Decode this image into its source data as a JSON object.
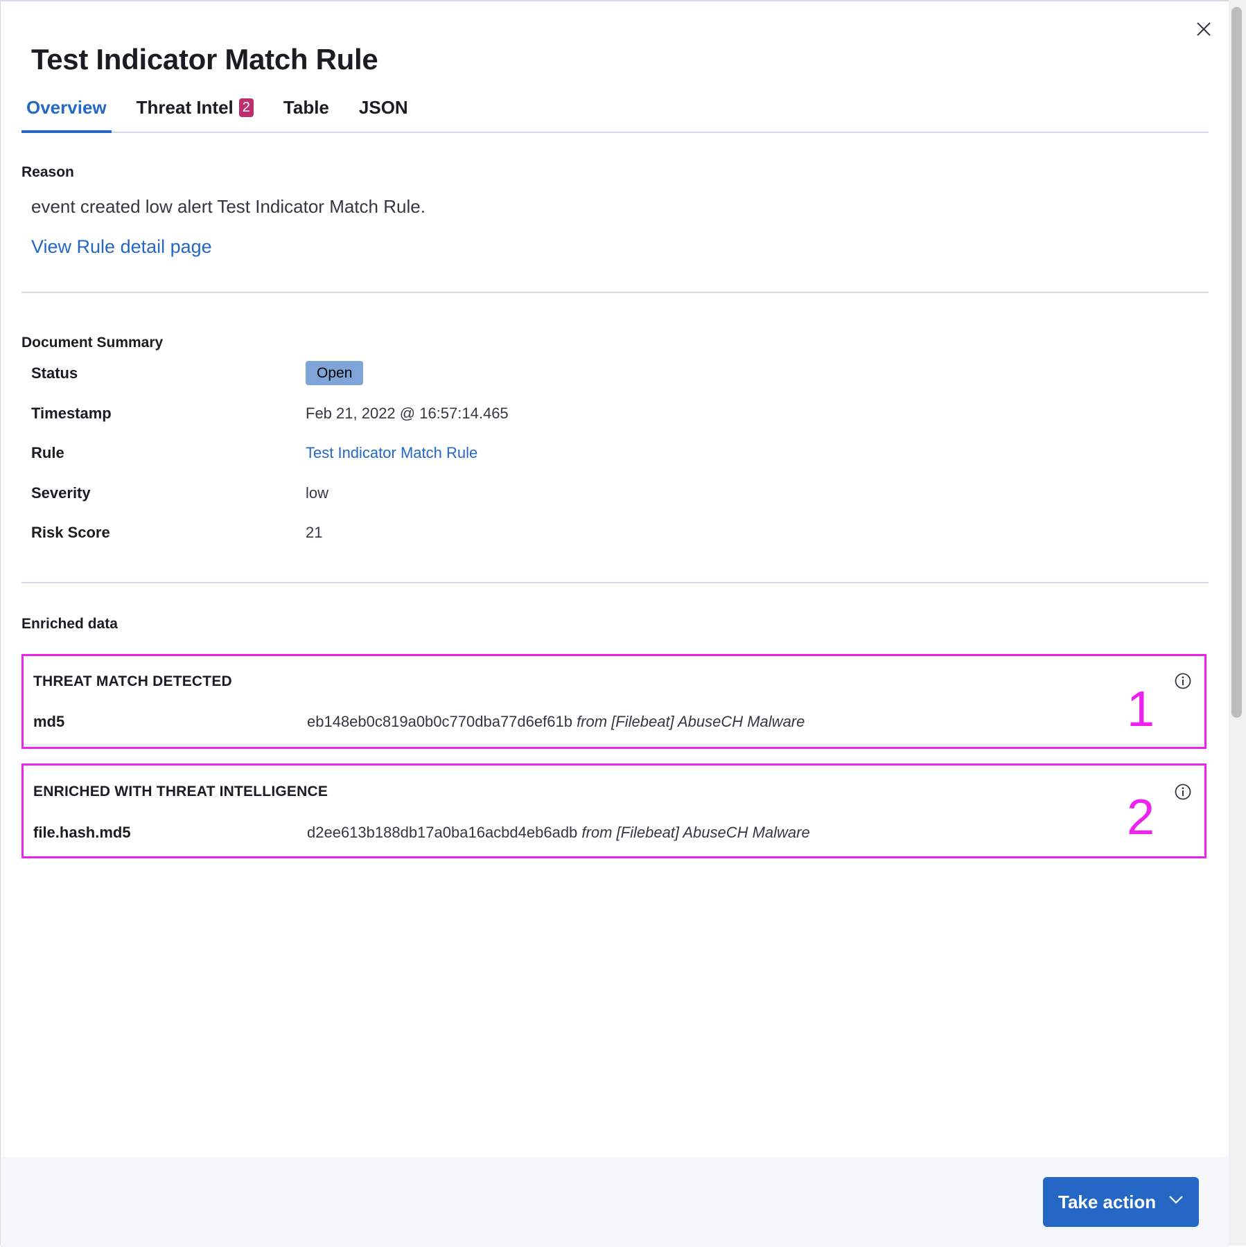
{
  "flyout": {
    "title": "Test Indicator Match Rule",
    "close_icon": "close-icon"
  },
  "tabs": [
    {
      "label": "Overview",
      "active": true
    },
    {
      "label": "Threat Intel",
      "badge": "2",
      "active": false
    },
    {
      "label": "Table",
      "active": false
    },
    {
      "label": "JSON",
      "active": false
    }
  ],
  "reason": {
    "label": "Reason",
    "text": "event created low alert Test Indicator Match Rule.",
    "link": "View Rule detail page"
  },
  "summary": {
    "label": "Document Summary",
    "rows": [
      {
        "key": "Status",
        "value": "Open"
      },
      {
        "key": "Timestamp",
        "value": "Feb 21, 2022 @ 16:57:14.465"
      },
      {
        "key": "Rule",
        "value": "Test Indicator Match Rule"
      },
      {
        "key": "Severity",
        "value": "low"
      },
      {
        "key": "Risk Score",
        "value": "21"
      }
    ]
  },
  "enriched": {
    "label": "Enriched data",
    "boxes": [
      {
        "heading": "THREAT MATCH DETECTED",
        "field": "md5",
        "hash": "eb148eb0c819a0b0c770dba77d6ef61b",
        "source": "from [Filebeat] AbuseCH Malware",
        "annotation": "1"
      },
      {
        "heading": "ENRICHED WITH THREAT INTELLIGENCE",
        "field": "file.hash.md5",
        "hash": "d2ee613b188db17a0ba16acbd4eb6adb",
        "source": "from [Filebeat] AbuseCH Malware",
        "annotation": "2"
      }
    ]
  },
  "footer": {
    "take_action_label": "Take action",
    "take_action_icon": "chevron-down-icon"
  },
  "colors": {
    "accent": "#2467c5",
    "badge": "#bd2f6e",
    "status": "#7fa4d8",
    "annotation": "#ee22ee"
  }
}
